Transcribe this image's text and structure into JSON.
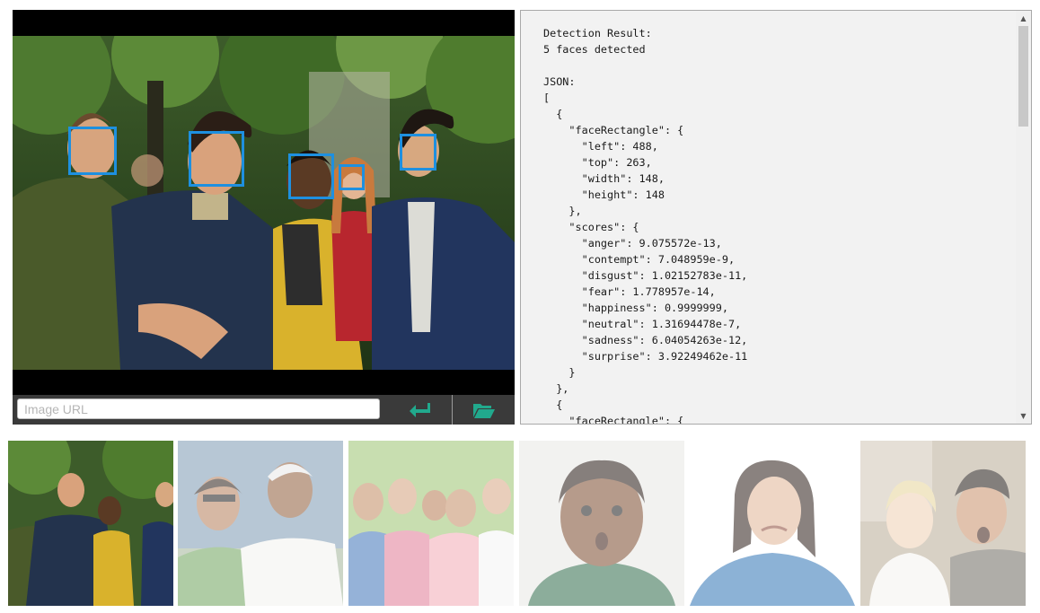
{
  "url_input": {
    "placeholder": "Image URL",
    "value": ""
  },
  "buttons": {
    "submit_icon": "return-arrow-icon",
    "browse_icon": "folder-open-icon",
    "accent_color": "#21a98d"
  },
  "face_box_color": "#1e90e0",
  "result": {
    "text": "Detection Result:\n5 faces detected\n\nJSON:\n[\n  {\n    \"faceRectangle\": {\n      \"left\": 488,\n      \"top\": 263,\n      \"width\": 148,\n      \"height\": 148\n    },\n    \"scores\": {\n      \"anger\": 9.075572e-13,\n      \"contempt\": 7.048959e-9,\n      \"disgust\": 1.02152783e-11,\n      \"fear\": 1.778957e-14,\n      \"happiness\": 0.9999999,\n      \"neutral\": 1.31694478e-7,\n      \"sadness\": 6.04054263e-12,\n      \"surprise\": 3.92249462e-11\n    }\n  },\n  {\n    \"faceRectangle\": {"
  },
  "thumbnails": [
    {
      "subject": "group of five friends in a park",
      "selected": true
    },
    {
      "subject": "smiling senior couple",
      "selected": false
    },
    {
      "subject": "happy multigenerational family",
      "selected": false
    },
    {
      "subject": "surprised young boy",
      "selected": false
    },
    {
      "subject": "woman with disgusted expression",
      "selected": false
    },
    {
      "subject": "surprised father and toddler",
      "selected": false
    }
  ]
}
